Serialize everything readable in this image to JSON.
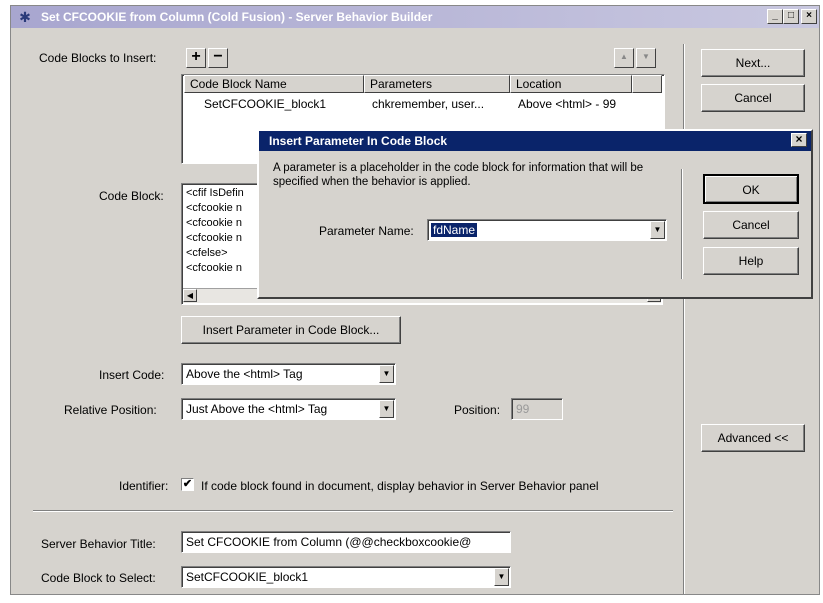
{
  "window": {
    "title": "Set CFCOOKIE from Column (Cold Fusion) - Server Behavior Builder",
    "minimize": "_",
    "maximize": "□",
    "close": "×"
  },
  "code_blocks": {
    "label": "Code Blocks to Insert:",
    "add": "+",
    "remove": "−",
    "up": "▲",
    "down": "▼",
    "columns": [
      "Code Block Name",
      "Parameters",
      "Location"
    ],
    "rows": [
      {
        "name": "SetCFCOOKIE_block1",
        "params": "chkremember, user...",
        "location": "Above <html> - 99"
      }
    ]
  },
  "code_block": {
    "label": "Code Block:",
    "lines": [
      "<cfif IsDefin",
      "<cfcookie n",
      "<cfcookie n",
      "<cfcookie n",
      "<cfelse>",
      "<cfcookie n"
    ],
    "insert_param_button": "Insert Parameter in Code Block..."
  },
  "insert_code": {
    "label": "Insert Code:",
    "value": "Above the <html> Tag"
  },
  "relative_position": {
    "label": "Relative Position:",
    "value": "Just Above the <html> Tag"
  },
  "position": {
    "label": "Position:",
    "value": "99"
  },
  "identifier": {
    "label": "Identifier:",
    "text": "If code block found in document, display behavior in Server Behavior panel",
    "mark": "✔"
  },
  "sb_title": {
    "label": "Server Behavior Title:",
    "value": "Set CFCOOKIE from Column (@@checkboxcookie@"
  },
  "code_select": {
    "label": "Code Block to Select:",
    "value": "SetCFCOOKIE_block1"
  },
  "buttons": {
    "next": "Next...",
    "cancel": "Cancel",
    "advanced": "Advanced <<"
  },
  "dialog": {
    "title": "Insert Parameter In Code Block",
    "close": "×",
    "description": "A parameter is a placeholder in the code block for information that will be specified when the behavior is applied.",
    "param_label": "Parameter Name:",
    "param_value": "fdName",
    "ok": "OK",
    "cancel": "Cancel",
    "help": "Help"
  },
  "colors": {
    "dialog_title": "#0a246a",
    "window_title": "#a8a6cf",
    "face": "#d6d3ce",
    "selection": "#0a246a"
  }
}
